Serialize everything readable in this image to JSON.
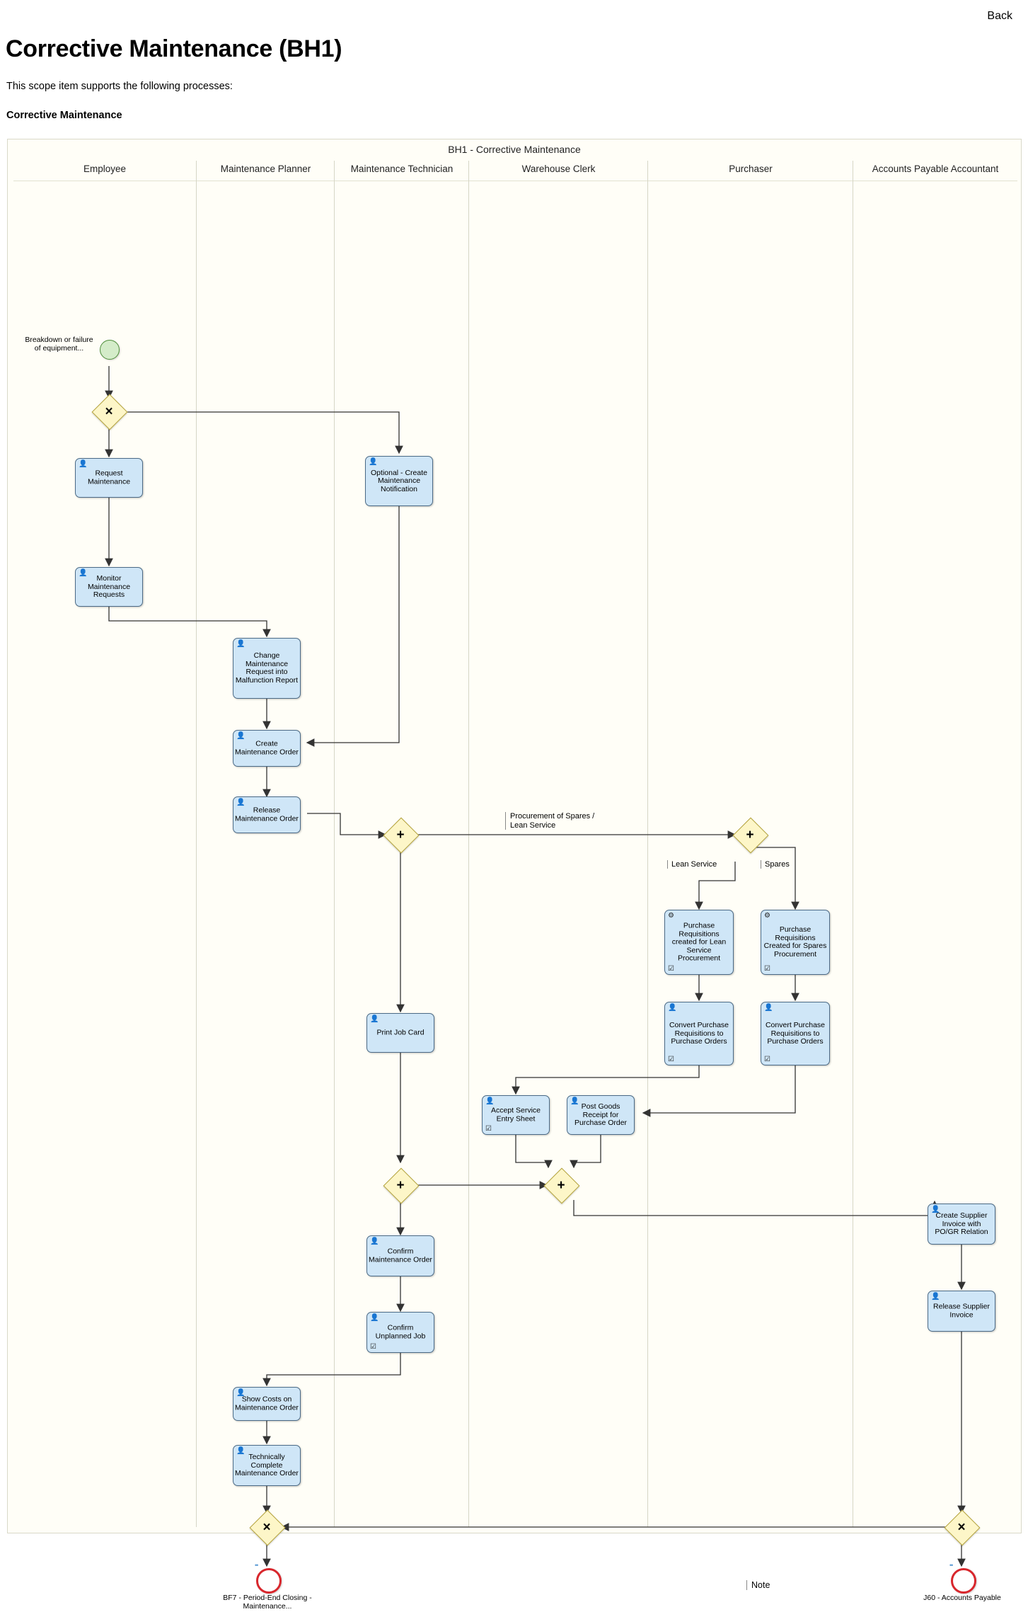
{
  "header": {
    "back_label": "Back",
    "title": "Corrective Maintenance (BH1)",
    "subtitle": "This scope item supports the following processes:",
    "process_name": "Corrective Maintenance"
  },
  "diagram": {
    "pool_title": "BH1 - Corrective Maintenance",
    "lanes": [
      {
        "label": "Employee"
      },
      {
        "label": "Maintenance Planner"
      },
      {
        "label": "Maintenance Technician"
      },
      {
        "label": "Warehouse Clerk"
      },
      {
        "label": "Purchaser"
      },
      {
        "label": "Accounts Payable Accountant"
      }
    ],
    "start_event": {
      "label": "Breakdown or failure of equipment..."
    },
    "end_events": [
      {
        "label": "BF7 - Period-End Closing - Maintenance..."
      },
      {
        "label": "J60 - Accounts Payable"
      }
    ],
    "tasks": [
      {
        "id": "t1",
        "label": "Request Maintenance",
        "icon": "user-icon",
        "mark": ""
      },
      {
        "id": "t2",
        "label": "Monitor Maintenance Requests",
        "icon": "user-icon",
        "mark": ""
      },
      {
        "id": "t3",
        "label": "Optional - Create Maintenance Notification",
        "icon": "user-icon",
        "mark": ""
      },
      {
        "id": "t4",
        "label": "Change Maintenance Request into Malfunction Report",
        "icon": "user-icon",
        "mark": ""
      },
      {
        "id": "t5",
        "label": "Create Maintenance Order",
        "icon": "user-icon",
        "mark": ""
      },
      {
        "id": "t6",
        "label": "Release Maintenance Order",
        "icon": "user-icon",
        "mark": ""
      },
      {
        "id": "t7",
        "label": "Purchase Requisitions created for Lean Service Procurement",
        "icon": "gear-icon",
        "mark": "checkbox-icon"
      },
      {
        "id": "t8",
        "label": "Purchase Requisitions Created for Spares Procurement",
        "icon": "gear-icon",
        "mark": "checkbox-icon"
      },
      {
        "id": "t9",
        "label": "Convert Purchase Requisitions to Purchase Orders",
        "icon": "user-icon",
        "mark": "checkbox-icon"
      },
      {
        "id": "t10",
        "label": "Convert Purchase Requisitions to Purchase Orders",
        "icon": "user-icon",
        "mark": "checkbox-icon"
      },
      {
        "id": "t11",
        "label": "Print Job Card",
        "icon": "user-icon",
        "mark": ""
      },
      {
        "id": "t12",
        "label": "Accept Service Entry Sheet",
        "icon": "user-icon",
        "mark": "checkbox-icon"
      },
      {
        "id": "t13",
        "label": "Post Goods Receipt for Purchase Order",
        "icon": "user-icon",
        "mark": ""
      },
      {
        "id": "t14",
        "label": "Confirm Maintenance Order",
        "icon": "user-icon",
        "mark": ""
      },
      {
        "id": "t15",
        "label": "Confirm Unplanned Job",
        "icon": "user-icon",
        "mark": "checkbox-icon"
      },
      {
        "id": "t16",
        "label": "Show Costs on Maintenance Order",
        "icon": "user-icon",
        "mark": ""
      },
      {
        "id": "t17",
        "label": "Technically Complete Maintenance Order",
        "icon": "user-icon",
        "mark": ""
      },
      {
        "id": "t18",
        "label": "Create Supplier Invoice with PO/GR Relation",
        "icon": "user-icon",
        "mark": ""
      },
      {
        "id": "t19",
        "label": "Release Supplier Invoice",
        "icon": "user-icon",
        "mark": ""
      }
    ],
    "gateways": [
      {
        "id": "g1",
        "symbol": "×"
      },
      {
        "id": "g2",
        "symbol": "+"
      },
      {
        "id": "g3",
        "symbol": "+"
      },
      {
        "id": "g4",
        "symbol": "+"
      },
      {
        "id": "g5",
        "symbol": "+"
      },
      {
        "id": "g6",
        "symbol": "×"
      },
      {
        "id": "g7",
        "symbol": "×"
      }
    ],
    "annotations": [
      {
        "id": "a1",
        "text": "Procurement of Spares / Lean Service"
      },
      {
        "id": "a2",
        "text": "Lean Service"
      },
      {
        "id": "a3",
        "text": "Spares"
      }
    ],
    "note": {
      "label": "Note"
    }
  },
  "colors": {
    "task_fill": "#cfe6f7",
    "task_border": "#4b6a86",
    "gateway_fill": "#fdf6c8",
    "gateway_border": "#b3a23d",
    "start_fill": "#d4ecc9",
    "start_border": "#4f8f3c",
    "end_border": "#d8262c",
    "pool_bg": "#fffef7"
  }
}
